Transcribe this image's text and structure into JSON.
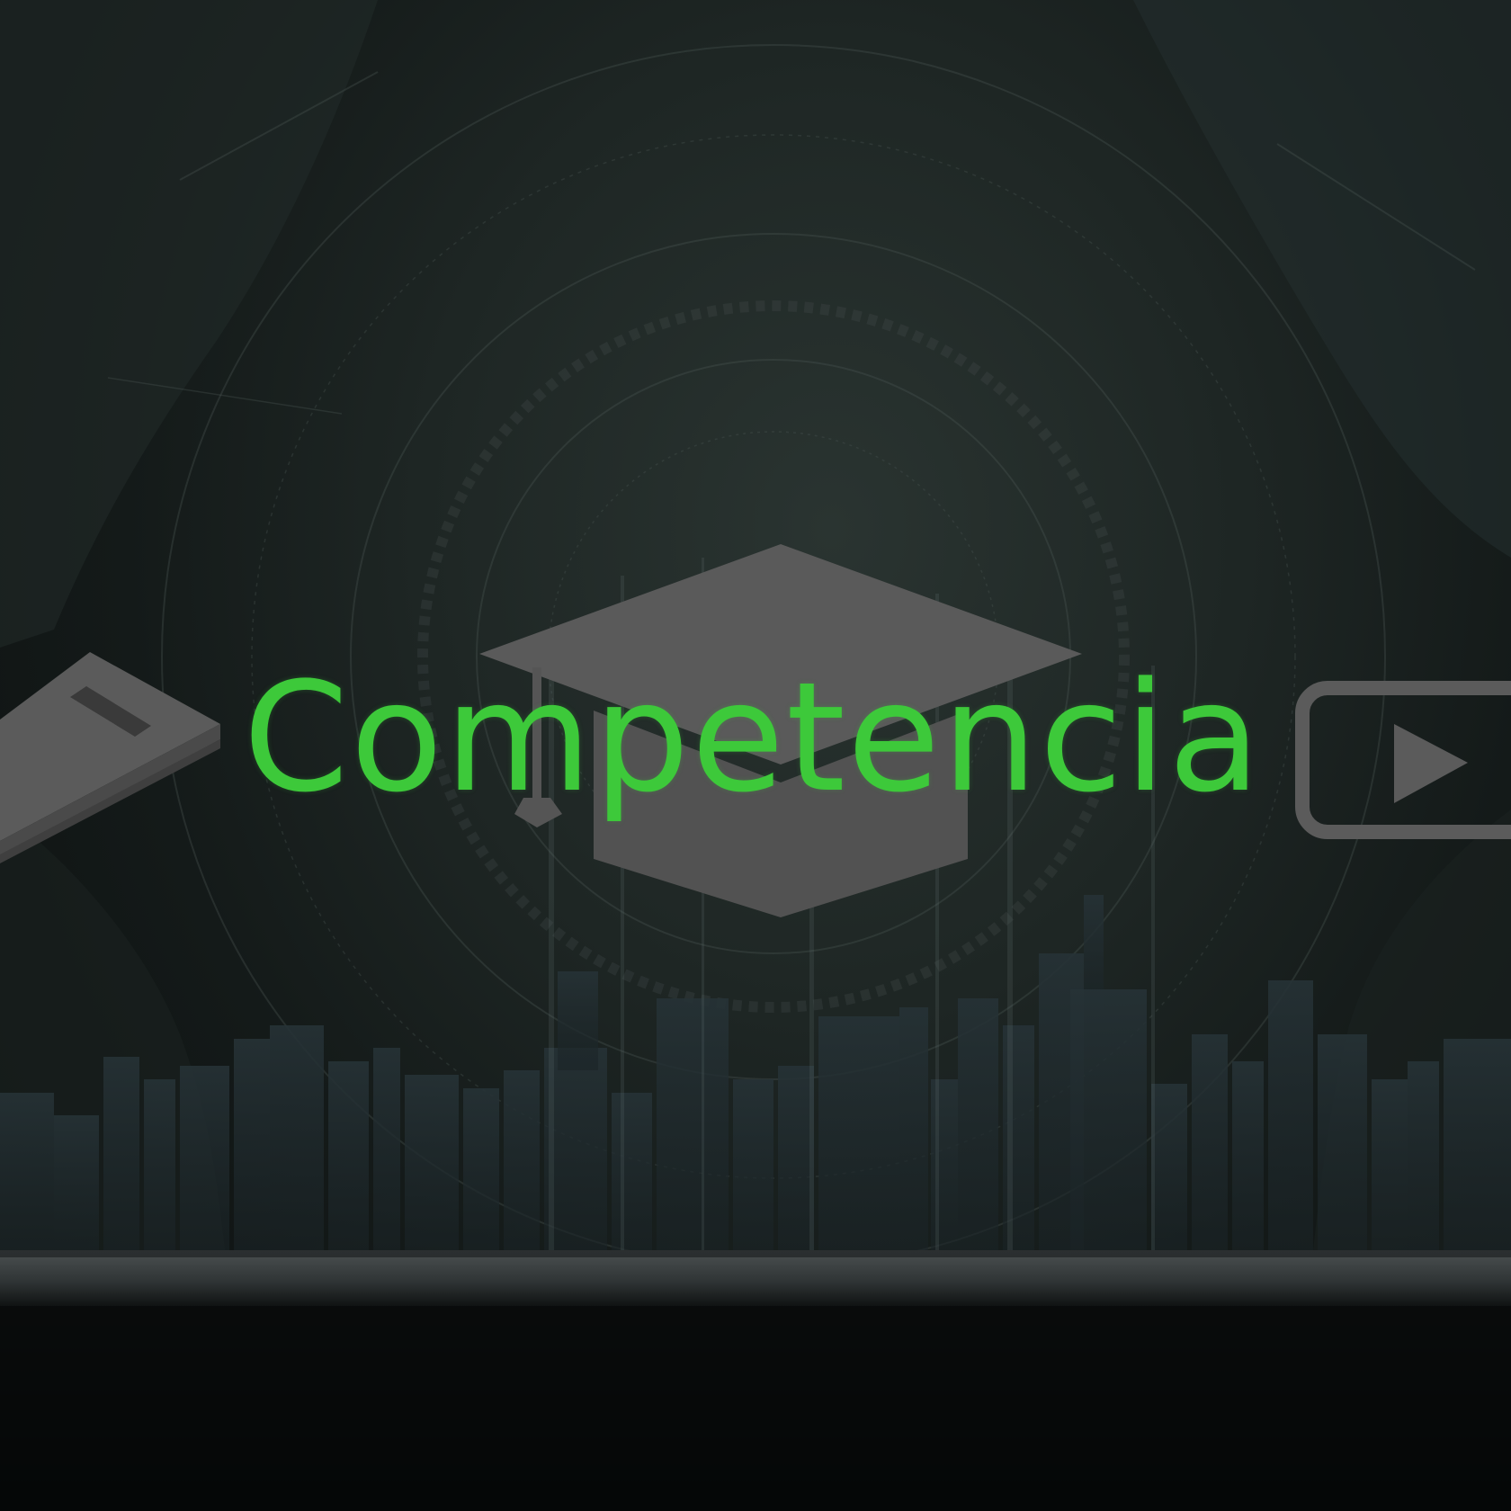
{
  "title": "Competencia",
  "colors": {
    "title": "#3dc93a",
    "icons": "#5b5b5b",
    "background": "#1e2624"
  },
  "icons": [
    "book-icon",
    "graduation-cap-icon",
    "video-play-icon",
    "city-skyline",
    "circular-hud"
  ]
}
